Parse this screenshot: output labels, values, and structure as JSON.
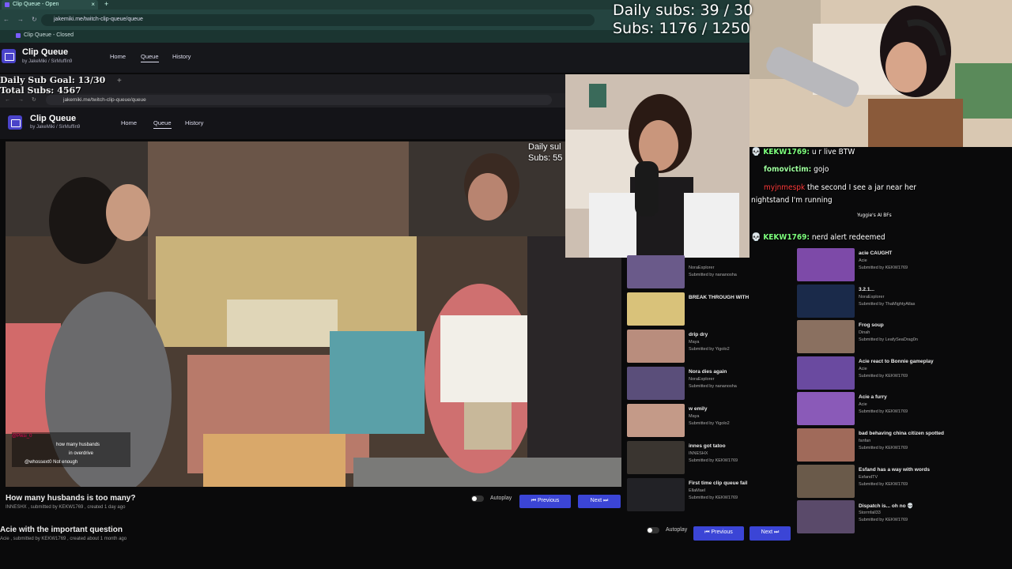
{
  "stats_top": {
    "daily": "Daily subs: 39 / 30",
    "total": "Subs: 1176 / 1250"
  },
  "stats_inner": {
    "daily": "Daily Sub Goal: 13/30",
    "total": "Total Subs: 4567"
  },
  "video_overlay_stats": {
    "daily": "Daily sul",
    "subs": "Subs: 55"
  },
  "outer_browser": {
    "tab_title": "Clip Queue - Open",
    "url": "jakemiki.me/twitch-clip-queue/queue",
    "bookmark": "Clip Queue - Closed"
  },
  "inner_browser": {
    "url": "jakemiki.me/twitch-clip-queue/queue"
  },
  "app": {
    "title": "Clip Queue",
    "by": "by",
    "authors": "JakeMiki / SirMuffin9",
    "nav": [
      "Home",
      "Queue",
      "History"
    ]
  },
  "current_clip": {
    "title": "How many husbands is too many?",
    "meta": "INNESHX , submitted by KEKW1769 , created 1 day ago"
  },
  "outer_clip": {
    "title": "Acie with the important question",
    "meta": "Acie , submitted by KEKW1769 , created about 1 month ago"
  },
  "controls": {
    "autoplay": "Autoplay",
    "previous": "Previous",
    "next": "Next"
  },
  "chat": [
    {
      "user": "KEKW1769:",
      "text": " u r live BTW",
      "kind": "msg"
    },
    {
      "user": "fomovictim:",
      "text": " gojo",
      "kind": "msg"
    },
    {
      "user": "myjnmespk",
      "text": " the second I see a jar near her",
      "kind": "red"
    },
    {
      "user": "",
      "text": "nightstand I'm running",
      "kind": "cont"
    },
    {
      "user": "",
      "text": "Yuggie's AI BFs",
      "kind": "clip"
    },
    {
      "user": "KEKW1769:",
      "text": " nerd alert redeemed",
      "kind": "msg"
    }
  ],
  "video_chat": [
    {
      "user": "@Piksi_0",
      "text": ""
    },
    {
      "user": "",
      "text": "how many husbands"
    },
    {
      "user": "",
      "text": "in overdrive"
    },
    {
      "user": "",
      "text": "@whossext0 Not enough"
    }
  ],
  "inner_queue": [
    {
      "title": "",
      "author": "NoraExplorer",
      "sub": "Submitted by nananosha",
      "color": "#6a5a8a"
    },
    {
      "title": "BREAK THROUGH WITH",
      "author": "",
      "sub": "",
      "color": "#d9c27a"
    },
    {
      "title": "drip dry",
      "author": "Maya",
      "sub": "Submitted by Yigolo2",
      "color": "#b98d7d"
    },
    {
      "title": "Nora dies again",
      "author": "NoraExplorer",
      "sub": "Submitted by nananosha",
      "color": "#5a4e7a"
    },
    {
      "title": "w emily",
      "author": "Maya",
      "sub": "Submitted by Yigolo2",
      "color": "#c49a88"
    },
    {
      "title": "innes got tatoo",
      "author": "INNESHX",
      "sub": "Submitted by KEKW1769",
      "color": "#3a3530"
    },
    {
      "title": "First time clip queue fail",
      "author": "EllaMael",
      "sub": "Submitted by KEKW1769",
      "color": "#222226"
    }
  ],
  "outer_queue": [
    {
      "title": "acie CAUGHT",
      "author": "Acie",
      "sub": "Submitted by KEKW1769",
      "color": "#7d4aa8"
    },
    {
      "title": "3.2.1...",
      "author": "NoraExplorer",
      "sub": "Submitted by ThaMightyAtlas",
      "color": "#1a2a4a"
    },
    {
      "title": "Frog soup",
      "author": "Dinah",
      "sub": "Submitted by LeafySeaDrag0n",
      "color": "#8a7060"
    },
    {
      "title": "Acie react to Bonnie gameplay",
      "author": "Acie",
      "sub": "Submitted by KEKW1769",
      "color": "#6a4aa0"
    },
    {
      "title": "Acie a furry",
      "author": "Acie",
      "sub": "Submitted by KEKW1769",
      "color": "#8a5ab8"
    },
    {
      "title": "bad behaving china citizen spotted",
      "author": "fanfan",
      "sub": "Submitted by KEKW1769",
      "color": "#a06a5a"
    },
    {
      "title": "Esfand has a way with words",
      "author": "EsfandTV",
      "sub": "Submitted by KEKW1769",
      "color": "#6a5a4a"
    },
    {
      "title": "Dispatch is... oh no 💀",
      "author": "Stormfall33",
      "sub": "Submitted by KEKW1769",
      "color": "#5a4a6a"
    }
  ],
  "colors": {
    "accent": "#3b45d6",
    "chat_user": "#7dff7d",
    "outer_chrome": "#244440"
  }
}
